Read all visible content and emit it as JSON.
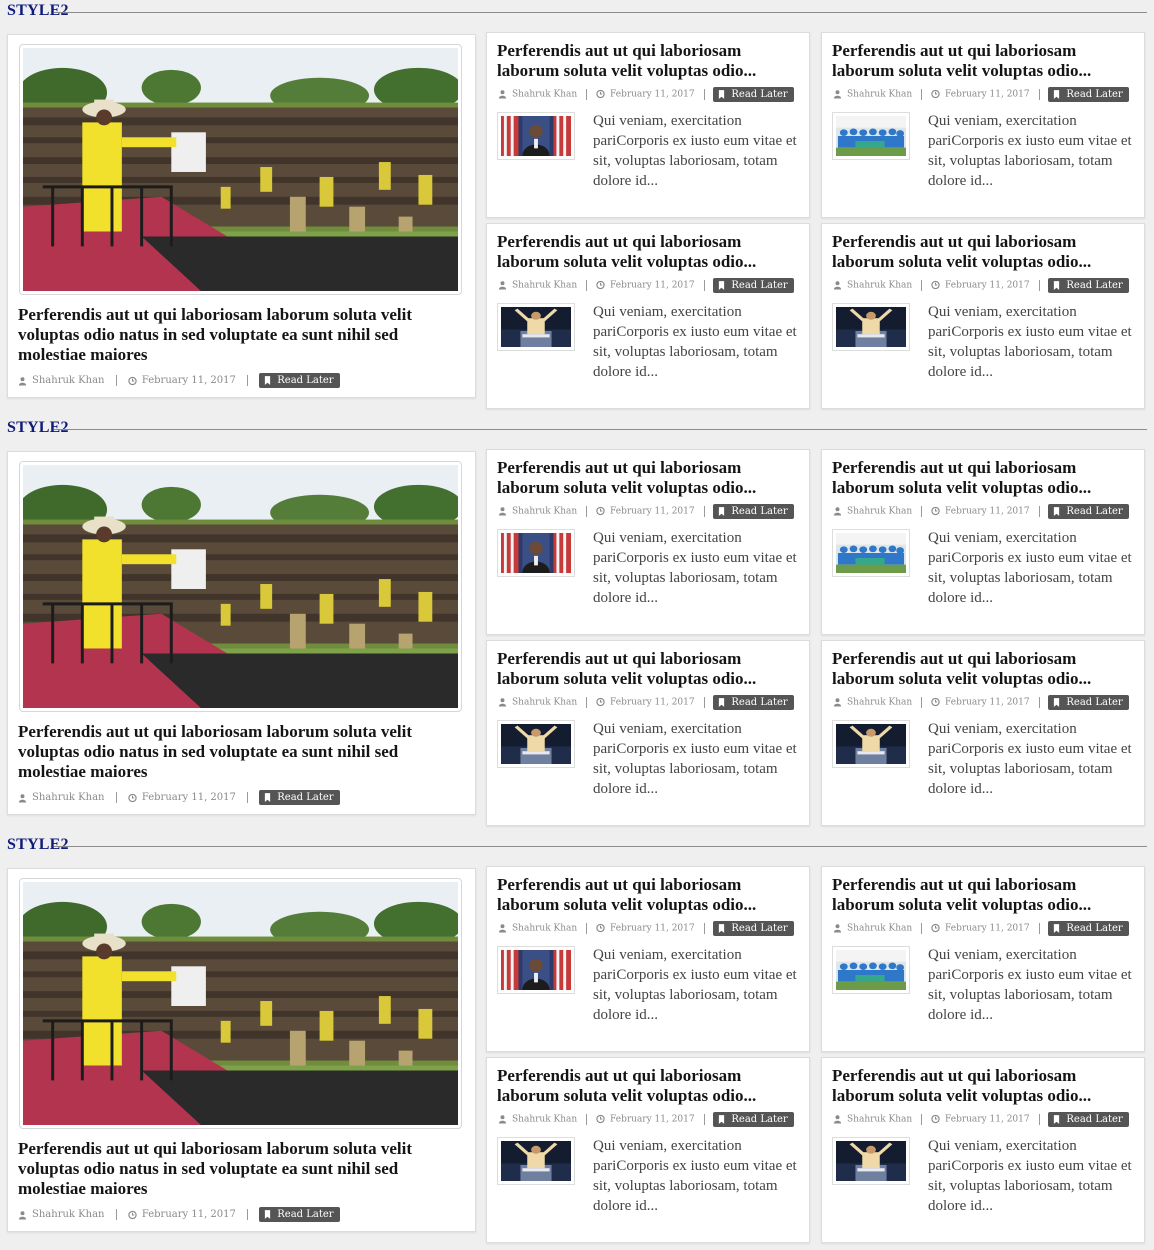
{
  "sections": [
    {
      "title": "STYLE2",
      "featured": {
        "image": "rally-speech-photo",
        "title": "Perferendis aut ut qui laboriosam laborum soluta velit voluptas odio natus in sed voluptate ea sunt nihil sed molestiae maiores",
        "author": "Shahruk Khan",
        "date": "February 11, 2017",
        "read_later": "Read Later"
      },
      "posts": [
        {
          "image": "president-podium-photo",
          "title": "Perferendis aut ut qui laboriosam laborum soluta velit voluptas odio...",
          "author": "Shahruk Khan",
          "date": "February 11, 2017",
          "read_later": "Read Later",
          "excerpt": "Qui veniam, exercitation pariCorporis ex iusto eum vitae et sit, voluptas laboriosam, totam dolore id..."
        },
        {
          "image": "team-group-photo",
          "title": "Perferendis aut ut qui laboriosam laborum soluta velit voluptas odio...",
          "author": "Shahruk Khan",
          "date": "February 11, 2017",
          "read_later": "Read Later",
          "excerpt": "Qui veniam, exercitation pariCorporis ex iusto eum vitae et sit, voluptas laboriosam, totam dolore id..."
        },
        {
          "image": "speaker-raised-hands-photo",
          "title": "Perferendis aut ut qui laboriosam laborum soluta velit voluptas odio...",
          "author": "Shahruk Khan",
          "date": "February 11, 2017",
          "read_later": "Read Later",
          "excerpt": "Qui veniam, exercitation pariCorporis ex iusto eum vitae et sit, voluptas laboriosam, totam dolore id..."
        },
        {
          "image": "speaker-raised-hands-photo",
          "title": "Perferendis aut ut qui laboriosam laborum soluta velit voluptas odio...",
          "author": "Shahruk Khan",
          "date": "February 11, 2017",
          "read_later": "Read Later",
          "excerpt": "Qui veniam, exercitation pariCorporis ex iusto eum vitae et sit, voluptas laboriosam, totam dolore id..."
        }
      ]
    },
    {
      "title": "STYLE2",
      "featured": {
        "image": "rally-speech-photo",
        "title": "Perferendis aut ut qui laboriosam laborum soluta velit voluptas odio natus in sed voluptate ea sunt nihil sed molestiae maiores",
        "author": "Shahruk Khan",
        "date": "February 11, 2017",
        "read_later": "Read Later"
      },
      "posts": [
        {
          "image": "president-podium-photo",
          "title": "Perferendis aut ut qui laboriosam laborum soluta velit voluptas odio...",
          "author": "Shahruk Khan",
          "date": "February 11, 2017",
          "read_later": "Read Later",
          "excerpt": "Qui veniam, exercitation pariCorporis ex iusto eum vitae et sit, voluptas laboriosam, totam dolore id..."
        },
        {
          "image": "team-group-photo",
          "title": "Perferendis aut ut qui laboriosam laborum soluta velit voluptas odio...",
          "author": "Shahruk Khan",
          "date": "February 11, 2017",
          "read_later": "Read Later",
          "excerpt": "Qui veniam, exercitation pariCorporis ex iusto eum vitae et sit, voluptas laboriosam, totam dolore id..."
        },
        {
          "image": "speaker-raised-hands-photo",
          "title": "Perferendis aut ut qui laboriosam laborum soluta velit voluptas odio...",
          "author": "Shahruk Khan",
          "date": "February 11, 2017",
          "read_later": "Read Later",
          "excerpt": "Qui veniam, exercitation pariCorporis ex iusto eum vitae et sit, voluptas laboriosam, totam dolore id..."
        },
        {
          "image": "speaker-raised-hands-photo",
          "title": "Perferendis aut ut qui laboriosam laborum soluta velit voluptas odio...",
          "author": "Shahruk Khan",
          "date": "February 11, 2017",
          "read_later": "Read Later",
          "excerpt": "Qui veniam, exercitation pariCorporis ex iusto eum vitae et sit, voluptas laboriosam, totam dolore id..."
        }
      ]
    },
    {
      "title": "STYLE2",
      "featured": {
        "image": "rally-speech-photo",
        "title": "Perferendis aut ut qui laboriosam laborum soluta velit voluptas odio natus in sed voluptate ea sunt nihil sed molestiae maiores",
        "author": "Shahruk Khan",
        "date": "February 11, 2017",
        "read_later": "Read Later"
      },
      "posts": [
        {
          "image": "president-podium-photo",
          "title": "Perferendis aut ut qui laboriosam laborum soluta velit voluptas odio...",
          "author": "Shahruk Khan",
          "date": "February 11, 2017",
          "read_later": "Read Later",
          "excerpt": "Qui veniam, exercitation pariCorporis ex iusto eum vitae et sit, voluptas laboriosam, totam dolore id..."
        },
        {
          "image": "team-group-photo",
          "title": "Perferendis aut ut qui laboriosam laborum soluta velit voluptas odio...",
          "author": "Shahruk Khan",
          "date": "February 11, 2017",
          "read_later": "Read Later",
          "excerpt": "Qui veniam, exercitation pariCorporis ex iusto eum vitae et sit, voluptas laboriosam, totam dolore id..."
        },
        {
          "image": "speaker-raised-hands-photo",
          "title": "Perferendis aut ut qui laboriosam laborum soluta velit voluptas odio...",
          "author": "Shahruk Khan",
          "date": "February 11, 2017",
          "read_later": "Read Later",
          "excerpt": "Qui veniam, exercitation pariCorporis ex iusto eum vitae et sit, voluptas laboriosam, totam dolore id..."
        },
        {
          "image": "speaker-raised-hands-photo",
          "title": "Perferendis aut ut qui laboriosam laborum soluta velit voluptas odio...",
          "author": "Shahruk Khan",
          "date": "February 11, 2017",
          "read_later": "Read Later",
          "excerpt": "Qui veniam, exercitation pariCorporis ex iusto eum vitae et sit, voluptas laboriosam, totam dolore id..."
        }
      ]
    }
  ],
  "colors": {
    "section_title": "#0f1a7a",
    "read_later_bg": "#555555",
    "page_bg": "#efefef"
  }
}
